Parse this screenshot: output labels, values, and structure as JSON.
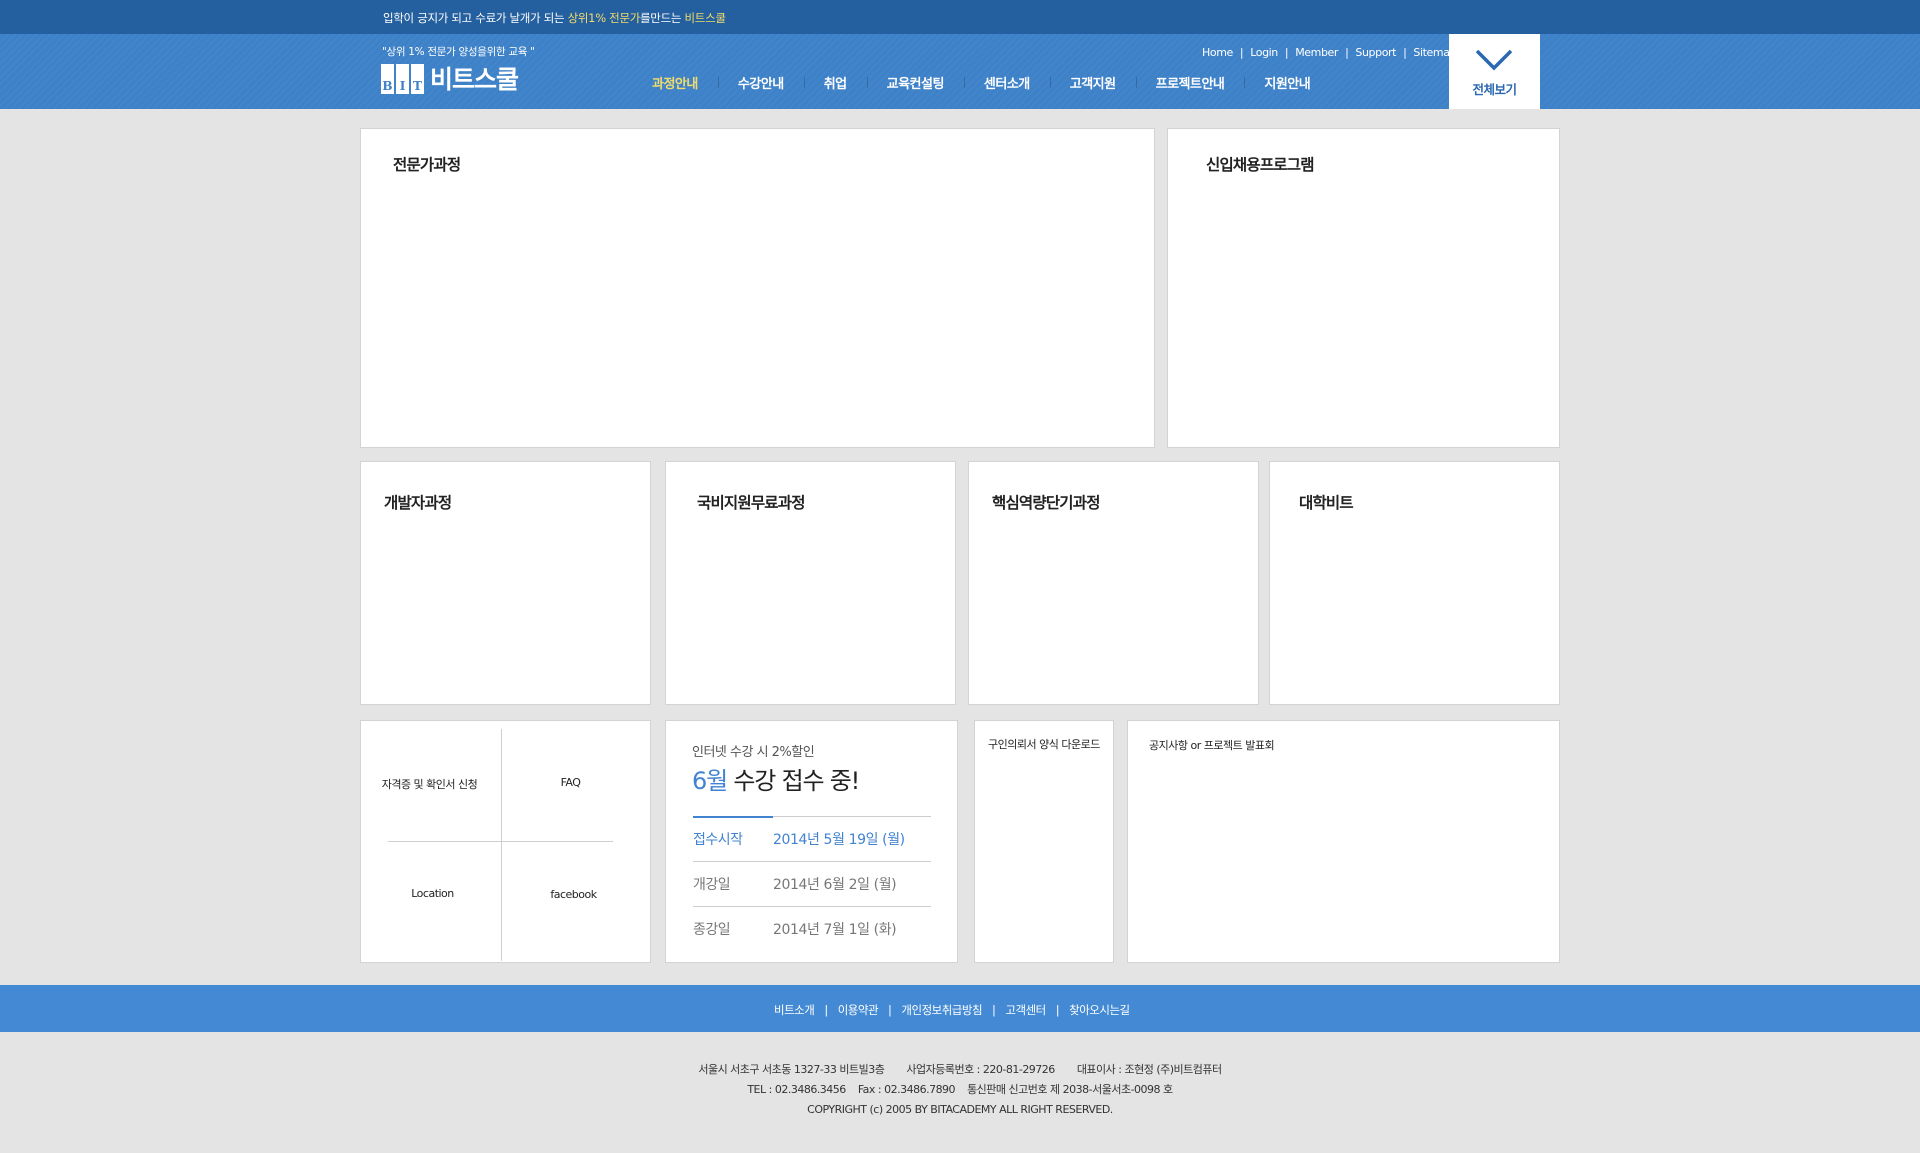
{
  "topbar": {
    "tagline_pre": "입학이 긍지가 되고 수료가 날개가 되는 ",
    "tagline_hl1": "상위1% 전문가",
    "tagline_mid": "를만드는 ",
    "tagline_hl2": "비트스쿨"
  },
  "header": {
    "slogan": "\"상위 1% 전문가 양성을위한 교육 \"",
    "logo_mark": [
      "B",
      "I",
      "T"
    ],
    "logo_text": "비트스쿨",
    "gnb": [
      "과정안내",
      "수강안내",
      "취업",
      "교육컨설팅",
      "센터소개",
      "고객지원",
      "프로젝트안내",
      "지원안내"
    ],
    "util": [
      "Home",
      "Login",
      "Member",
      "Support",
      "Sitemap"
    ],
    "util_sep": "|",
    "allview_label": "전체보기"
  },
  "main": {
    "row1": [
      "전문가과정",
      "신입채용프로그램"
    ],
    "row2": [
      "개발자과정",
      "국비지원무료과정",
      "핵심역량단기과정",
      "대학비트"
    ],
    "quick": [
      "자격증 및 확인서 신청",
      "FAQ",
      "Location",
      "facebook"
    ],
    "announce": {
      "subtitle": "인터넷 수강 시 2%할인",
      "month": "6월",
      "headline": " 수강 접수 중!",
      "rows": [
        {
          "label": "접수시작",
          "value": "2014년 5월 19일 (월)"
        },
        {
          "label": "개강일",
          "value": "2014년 6월 2일 (월)"
        },
        {
          "label": "종강일",
          "value": "2014년 7월 1일 (화)"
        }
      ]
    },
    "download_title": "구인의뢰서 양식 다운로드",
    "notice_title": "공지사항 or 프로젝트 발표회"
  },
  "footer": {
    "nav": [
      "비트소개",
      "이용약관",
      "개인정보취급방침",
      "고객센터",
      "찾아오시는길"
    ],
    "nav_sep": "|",
    "address": "서울시 서초구 서초동 1327-33 비트빌3층",
    "biz_no": "사업자등록번호 : 220-81-29726",
    "ceo": "대표이사 : 조현정 (주)비트컴퓨터",
    "tel": "TEL : 02.3486.3456",
    "fax": "Fax : 02.3486.7890",
    "mail_order": "통신판매 신고번호 제 2038-서울서초-0098 호",
    "copyright": "COPYRIGHT (c) 2005  BY BITACADEMY  ALL RIGHT RESERVED."
  },
  "colors": {
    "primary": "#3d81c8",
    "topbar": "#245f9f",
    "footer_nav": "#4389d3",
    "highlight": "#f2dc6b",
    "accent_text": "#4182d1"
  },
  "icons": {
    "allview": "chevron-down-icon"
  }
}
